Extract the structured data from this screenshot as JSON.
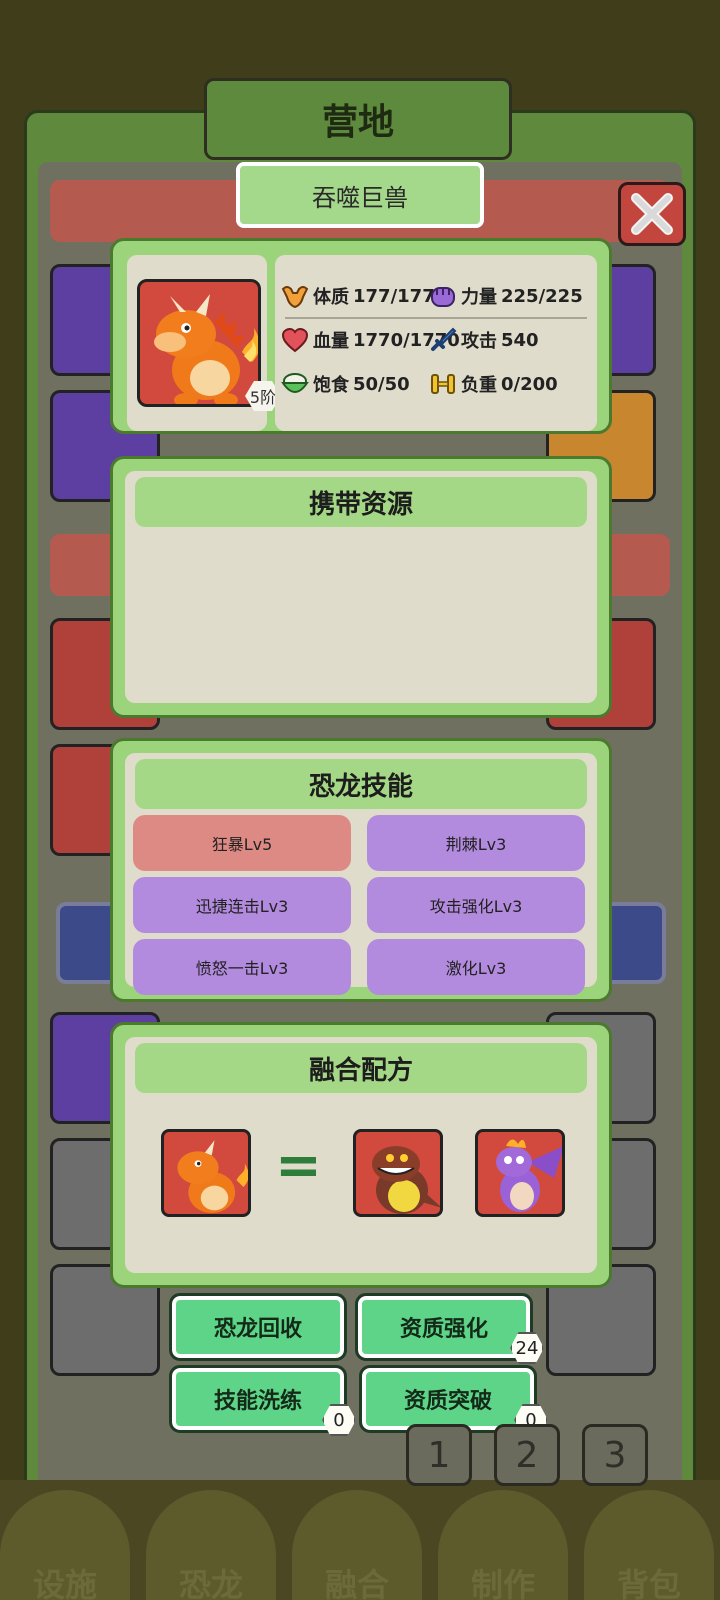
{
  "title": "营地",
  "dino_name": "吞噬巨兽",
  "stage": "5阶",
  "stats": {
    "constitution": {
      "label": "体质",
      "value": "177/177"
    },
    "strength": {
      "label": "力量",
      "value": "225/225"
    },
    "hp": {
      "label": "血量",
      "value": "1770/1770"
    },
    "attack": {
      "label": "攻击",
      "value": "540"
    },
    "satiety": {
      "label": "饱食",
      "value": "50/50"
    },
    "load": {
      "label": "负重",
      "value": "0/200"
    }
  },
  "resources": {
    "title": "携带资源"
  },
  "skills": {
    "title": "恐龙技能",
    "items": [
      {
        "label": "狂暴Lv5",
        "color": "#de8a84"
      },
      {
        "label": "荆棘Lv3",
        "color": "#b28ade"
      },
      {
        "label": "迅捷连击Lv3",
        "color": "#b28ade"
      },
      {
        "label": "攻击强化Lv3",
        "color": "#b28ade"
      },
      {
        "label": "愤怒一击Lv3",
        "color": "#b28ade"
      },
      {
        "label": "激化Lv3",
        "color": "#b28ade"
      }
    ]
  },
  "recipe": {
    "title": "融合配方",
    "equals": "="
  },
  "actions": {
    "recycle": "恐龙回收",
    "enhance": "资质强化",
    "enhance_count": "24",
    "reroll": "技能洗练",
    "reroll_count": "0",
    "breakthrough": "资质突破",
    "breakthrough_count": "0"
  },
  "pages": [
    "1",
    "2",
    "3"
  ],
  "nav": [
    "设施",
    "恐龙",
    "融合",
    "制作",
    "背包"
  ]
}
